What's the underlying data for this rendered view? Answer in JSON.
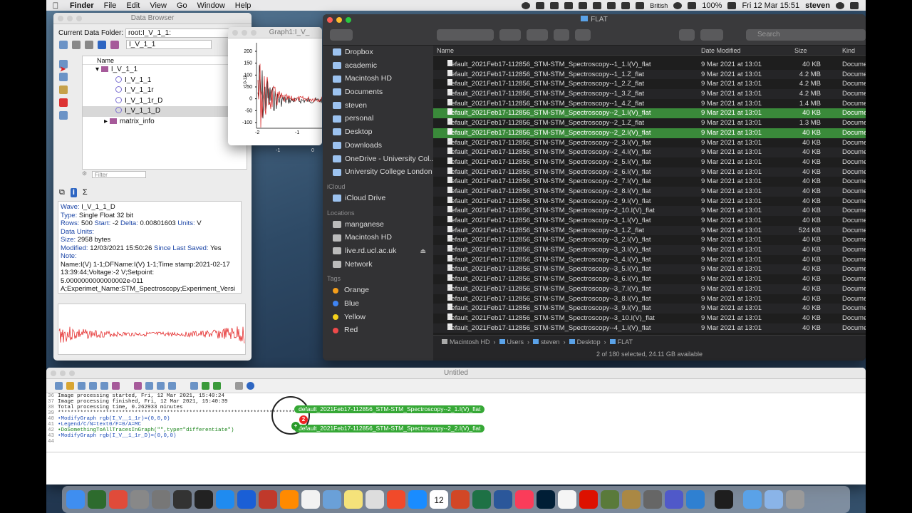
{
  "menubar": {
    "app": "Finder",
    "items": [
      "File",
      "Edit",
      "View",
      "Go",
      "Window",
      "Help"
    ],
    "input_source": "British",
    "battery": "100%",
    "datetime": "Fri 12 Mar  15:51",
    "user": "steven"
  },
  "data_browser": {
    "title": "Data Browser",
    "current_folder_label": "Current Data Folder:",
    "current_folder": "root:I_V_1_1:",
    "path_field": "I_V_1_1",
    "tree_header": "Name",
    "tree": [
      {
        "label": "I_V_1_1",
        "kind": "folder"
      },
      {
        "label": "I_V_1_1",
        "kind": "wave"
      },
      {
        "label": "I_V_1_1r",
        "kind": "wave"
      },
      {
        "label": "I_V_1_1r_D",
        "kind": "wave"
      },
      {
        "label": "I_V_1_1_D",
        "kind": "wave"
      },
      {
        "label": "matrix_info",
        "kind": "folder"
      }
    ],
    "filter_placeholder": "Filter",
    "info": {
      "wave_k": "Wave:",
      "wave_v": "I_V_1_1_D",
      "type_k": "Type:",
      "type_v": "Single Float 32 bit",
      "rows_k": "Rows:",
      "rows_v": "500",
      "start_k": "Start:",
      "start_v": "-2",
      "delta_k": "Delta:",
      "delta_v": "0.00801603",
      "units_k": "Units:",
      "units_v": "V",
      "dunits_k": "Data Units:",
      "size_k": "Size:",
      "size_v": "2958 bytes",
      "mod_k": "Modified:",
      "mod_v": "12/03/2021 15:50:26",
      "since_k": "Since Last Saved:",
      "since_v": "Yes",
      "note_k": "Note:",
      "note_1": "Name:I(V) 1-1;DFName:I(V) 1-1;Time stamp:2021-02-17",
      "note_2": "13:39:44;Voltage:-2 V;Setpoint:",
      "note_3": "5.0000000000000002e-011",
      "note_4": "A;Experimet_Name:STM_Spectroscopy;Experiment_Versi"
    }
  },
  "graph": {
    "title": "Graph1:I_V_",
    "y_ticks": [
      "200",
      "150",
      "100",
      "50",
      "0",
      "-50",
      "-100"
    ],
    "y_unit": "x10-12",
    "x_ticks": [
      "-2",
      "-1"
    ],
    "x_ticks_outer": [
      "-1",
      "0"
    ]
  },
  "finder": {
    "title": "FLAT",
    "search_placeholder": "Search",
    "sidebar": {
      "favorites": [
        "Dropbox",
        "academic",
        "Macintosh HD",
        "Documents",
        "steven",
        "personal",
        "Desktop",
        "Downloads",
        "OneDrive - University Col...",
        "University College London"
      ],
      "icloud_header": "iCloud",
      "icloud": [
        "iCloud Drive"
      ],
      "locations_header": "Locations",
      "locations": [
        "manganese",
        "Macintosh HD",
        "live.rd.ucl.ac.uk",
        "Network"
      ],
      "tags_header": "Tags",
      "tags": [
        {
          "label": "Orange",
          "color": "#f59e1b"
        },
        {
          "label": "Blue",
          "color": "#3f84f2"
        },
        {
          "label": "Yellow",
          "color": "#f5d11b"
        },
        {
          "label": "Red",
          "color": "#ef4a4a"
        }
      ]
    },
    "columns": {
      "name": "Name",
      "date": "Date Modified",
      "size": "Size",
      "kind": "Kind"
    },
    "rows": [
      {
        "name": "default_2021Feb17-112856_STM-STM_Spectroscopy--1_1.I(V)_flat",
        "date": "9 Mar 2021 at 13:01",
        "size": "40 KB",
        "kind": "Docume",
        "sel": false
      },
      {
        "name": "default_2021Feb17-112856_STM-STM_Spectroscopy--1_1.Z_flat",
        "date": "9 Mar 2021 at 13:01",
        "size": "4.2 MB",
        "kind": "Docume",
        "sel": false
      },
      {
        "name": "default_2021Feb17-112856_STM-STM_Spectroscopy--1_2.Z_flat",
        "date": "9 Mar 2021 at 13:01",
        "size": "4.2 MB",
        "kind": "Docume",
        "sel": false
      },
      {
        "name": "default_2021Feb17-112856_STM-STM_Spectroscopy--1_3.Z_flat",
        "date": "9 Mar 2021 at 13:01",
        "size": "4.2 MB",
        "kind": "Docume",
        "sel": false
      },
      {
        "name": "default_2021Feb17-112856_STM-STM_Spectroscopy--1_4.Z_flat",
        "date": "9 Mar 2021 at 13:01",
        "size": "1.4 MB",
        "kind": "Docume",
        "sel": false
      },
      {
        "name": "default_2021Feb17-112856_STM-STM_Spectroscopy--2_1.I(V)_flat",
        "date": "9 Mar 2021 at 13:01",
        "size": "40 KB",
        "kind": "Docume",
        "sel": true
      },
      {
        "name": "default_2021Feb17-112856_STM-STM_Spectroscopy--2_1.Z_flat",
        "date": "9 Mar 2021 at 13:01",
        "size": "1.3 MB",
        "kind": "Docume",
        "sel": false
      },
      {
        "name": "default_2021Feb17-112856_STM-STM_Spectroscopy--2_2.I(V)_flat",
        "date": "9 Mar 2021 at 13:01",
        "size": "40 KB",
        "kind": "Docume",
        "sel": true
      },
      {
        "name": "default_2021Feb17-112856_STM-STM_Spectroscopy--2_3.I(V)_flat",
        "date": "9 Mar 2021 at 13:01",
        "size": "40 KB",
        "kind": "Docume",
        "sel": false
      },
      {
        "name": "default_2021Feb17-112856_STM-STM_Spectroscopy--2_4.I(V)_flat",
        "date": "9 Mar 2021 at 13:01",
        "size": "40 KB",
        "kind": "Docume",
        "sel": false
      },
      {
        "name": "default_2021Feb17-112856_STM-STM_Spectroscopy--2_5.I(V)_flat",
        "date": "9 Mar 2021 at 13:01",
        "size": "40 KB",
        "kind": "Docume",
        "sel": false
      },
      {
        "name": "default_2021Feb17-112856_STM-STM_Spectroscopy--2_6.I(V)_flat",
        "date": "9 Mar 2021 at 13:01",
        "size": "40 KB",
        "kind": "Docume",
        "sel": false
      },
      {
        "name": "default_2021Feb17-112856_STM-STM_Spectroscopy--2_7.I(V)_flat",
        "date": "9 Mar 2021 at 13:01",
        "size": "40 KB",
        "kind": "Docume",
        "sel": false
      },
      {
        "name": "default_2021Feb17-112856_STM-STM_Spectroscopy--2_8.I(V)_flat",
        "date": "9 Mar 2021 at 13:01",
        "size": "40 KB",
        "kind": "Docume",
        "sel": false
      },
      {
        "name": "default_2021Feb17-112856_STM-STM_Spectroscopy--2_9.I(V)_flat",
        "date": "9 Mar 2021 at 13:01",
        "size": "40 KB",
        "kind": "Docume",
        "sel": false
      },
      {
        "name": "default_2021Feb17-112856_STM-STM_Spectroscopy--2_10.I(V)_flat",
        "date": "9 Mar 2021 at 13:01",
        "size": "40 KB",
        "kind": "Docume",
        "sel": false
      },
      {
        "name": "default_2021Feb17-112856_STM-STM_Spectroscopy--3_1.I(V)_flat",
        "date": "9 Mar 2021 at 13:01",
        "size": "40 KB",
        "kind": "Docume",
        "sel": false
      },
      {
        "name": "default_2021Feb17-112856_STM-STM_Spectroscopy--3_1.Z_flat",
        "date": "9 Mar 2021 at 13:01",
        "size": "524 KB",
        "kind": "Docume",
        "sel": false
      },
      {
        "name": "default_2021Feb17-112856_STM-STM_Spectroscopy--3_2.I(V)_flat",
        "date": "9 Mar 2021 at 13:01",
        "size": "40 KB",
        "kind": "Docume",
        "sel": false
      },
      {
        "name": "default_2021Feb17-112856_STM-STM_Spectroscopy--3_3.I(V)_flat",
        "date": "9 Mar 2021 at 13:01",
        "size": "40 KB",
        "kind": "Docume",
        "sel": false
      },
      {
        "name": "default_2021Feb17-112856_STM-STM_Spectroscopy--3_4.I(V)_flat",
        "date": "9 Mar 2021 at 13:01",
        "size": "40 KB",
        "kind": "Docume",
        "sel": false
      },
      {
        "name": "default_2021Feb17-112856_STM-STM_Spectroscopy--3_5.I(V)_flat",
        "date": "9 Mar 2021 at 13:01",
        "size": "40 KB",
        "kind": "Docume",
        "sel": false
      },
      {
        "name": "default_2021Feb17-112856_STM-STM_Spectroscopy--3_6.I(V)_flat",
        "date": "9 Mar 2021 at 13:01",
        "size": "40 KB",
        "kind": "Docume",
        "sel": false
      },
      {
        "name": "default_2021Feb17-112856_STM-STM_Spectroscopy--3_7.I(V)_flat",
        "date": "9 Mar 2021 at 13:01",
        "size": "40 KB",
        "kind": "Docume",
        "sel": false
      },
      {
        "name": "default_2021Feb17-112856_STM-STM_Spectroscopy--3_8.I(V)_flat",
        "date": "9 Mar 2021 at 13:01",
        "size": "40 KB",
        "kind": "Docume",
        "sel": false
      },
      {
        "name": "default_2021Feb17-112856_STM-STM_Spectroscopy--3_9.I(V)_flat",
        "date": "9 Mar 2021 at 13:01",
        "size": "40 KB",
        "kind": "Docume",
        "sel": false
      },
      {
        "name": "default_2021Feb17-112856_STM-STM_Spectroscopy--3_10.I(V)_flat",
        "date": "9 Mar 2021 at 13:01",
        "size": "40 KB",
        "kind": "Docume",
        "sel": false
      },
      {
        "name": "default_2021Feb17-112856_STM-STM_Spectroscopy--4_1.I(V)_flat",
        "date": "9 Mar 2021 at 13:01",
        "size": "40 KB",
        "kind": "Docume",
        "sel": false
      }
    ],
    "path": [
      "Macintosh HD",
      "Users",
      "steven",
      "Desktop",
      "FLAT"
    ],
    "status": "2 of 180 selected, 24.11 GB available"
  },
  "untitled": {
    "title": "Untitled",
    "history": [
      {
        "n": "36",
        "text": "Image processing started,   Fri, 12 Mar 2021, 15:40:24",
        "cls": ""
      },
      {
        "n": "37",
        "text": "Image processing finished,   Fri, 12 Mar 2021, 15:40:39",
        "cls": ""
      },
      {
        "n": "38",
        "text": "Total processing time,   0.262933  minutes",
        "cls": ""
      },
      {
        "n": "39",
        "text": "****************************************************************************************",
        "cls": ""
      },
      {
        "n": "40",
        "text": "•ModifyGraph rgb(I_V__1_1r)=(0,0,0)",
        "cls": "blue"
      },
      {
        "n": "41",
        "text": "•Legend/C/N=text0/F=0/A=MC",
        "cls": "blue"
      },
      {
        "n": "42",
        "text": "•DoSomethingToAllTracesInGraph(\"\",type=\"differentiate\")",
        "cls": "green"
      },
      {
        "n": "43",
        "text": "•ModifyGraph rgb(I_V__1_1r_D)=(0,0,0)",
        "cls": "blue"
      },
      {
        "n": "44",
        "text": "",
        "cls": ""
      }
    ],
    "drag_items": [
      "default_2021Feb17-112856_STM-STM_Spectroscopy--2_1.I(V)_flat",
      "default_2021Feb17-112856_STM-STM_Spectroscopy--2_2.I(V)_flat"
    ],
    "drag_count": "2"
  },
  "dock": {
    "apps": [
      "finder",
      "igor",
      "chrome",
      "launchpad",
      "system-preferences",
      "activity-monitor",
      "terminal",
      "app-store",
      "shazam",
      "mendeley",
      "firefox",
      "notes",
      "preview",
      "sticky",
      "texmaker",
      "brave",
      "safari",
      "calendar",
      "powerpoint",
      "excel",
      "word",
      "music",
      "photoshop",
      "textedit",
      "mathematica",
      "image-viewer",
      "vpn",
      "gimp",
      "teams",
      "vscode",
      "pycharm",
      "downloads",
      "finder-folder",
      "trash"
    ],
    "calendar_day": "12"
  }
}
